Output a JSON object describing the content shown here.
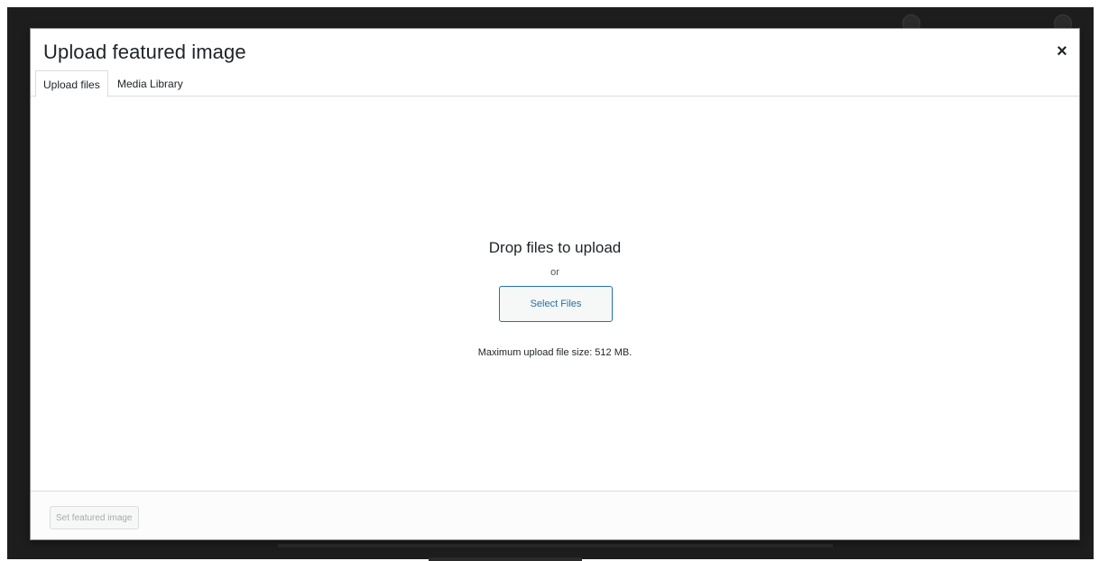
{
  "modal": {
    "title": "Upload featured image",
    "close_icon": "×"
  },
  "tabs": [
    {
      "label": "Upload files",
      "active": true
    },
    {
      "label": "Media Library",
      "active": false
    }
  ],
  "uploader": {
    "drop_text": "Drop files to upload",
    "or_text": "or",
    "select_button": "Select Files",
    "max_size": "Maximum upload file size: 512 MB."
  },
  "toolbar": {
    "set_button": "Set featured image",
    "set_button_disabled": true
  },
  "colors": {
    "accent": "#2271b1",
    "backdrop": "#1d1d1d"
  }
}
